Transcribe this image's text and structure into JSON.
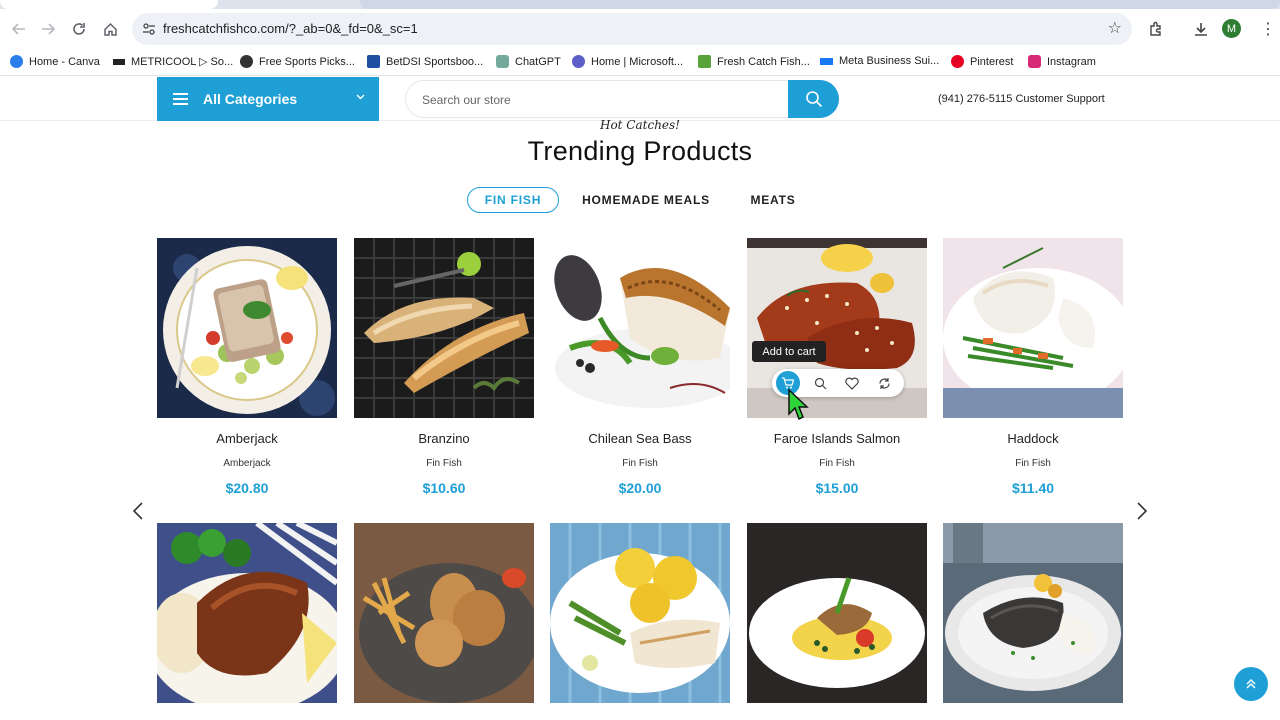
{
  "browser": {
    "url": "freshcatchfishco.com/?_ab=0&_fd=0&_sc=1",
    "profile_initial": "M",
    "bookmarks": [
      {
        "label": "Home - Canva",
        "color": "#2b7de9"
      },
      {
        "label": "METRICOOL ▷ So...",
        "color": "#222222"
      },
      {
        "label": "Free Sports Picks...",
        "color": "#333333"
      },
      {
        "label": "BetDSI Sportsboo...",
        "color": "#1f4fa0"
      },
      {
        "label": "ChatGPT",
        "color": "#74aa9c"
      },
      {
        "label": "Home | Microsoft...",
        "color": "#5b5fc7"
      },
      {
        "label": "Fresh Catch Fish...",
        "color": "#5aa33a"
      },
      {
        "label": "Meta Business Sui...",
        "color": "#1877f2"
      },
      {
        "label": "Pinterest",
        "color": "#e60023"
      },
      {
        "label": "Instagram",
        "color": "#d62976"
      }
    ]
  },
  "header": {
    "all_categories": "All Categories",
    "search_placeholder": "Search our store",
    "support": "(941) 276-5115 Customer Support"
  },
  "section": {
    "eyebrow": "Hot Catches!",
    "title": "Trending Products",
    "tabs": [
      "FIN FISH",
      "HOMEMADE MEALS",
      "MEATS"
    ],
    "active_tab": "FIN FISH"
  },
  "products_row1": [
    {
      "name": "Amberjack",
      "category": "Amberjack",
      "price": "$20.80"
    },
    {
      "name": "Branzino",
      "category": "Fin Fish",
      "price": "$10.60"
    },
    {
      "name": "Chilean Sea Bass",
      "category": "Fin Fish",
      "price": "$20.00"
    },
    {
      "name": "Faroe Islands Salmon",
      "category": "Fin Fish",
      "price": "$15.00"
    },
    {
      "name": "Haddock",
      "category": "Fin Fish",
      "price": "$11.40"
    }
  ],
  "tooltip": "Add to cart",
  "colors": {
    "accent": "#1e9fd6"
  }
}
